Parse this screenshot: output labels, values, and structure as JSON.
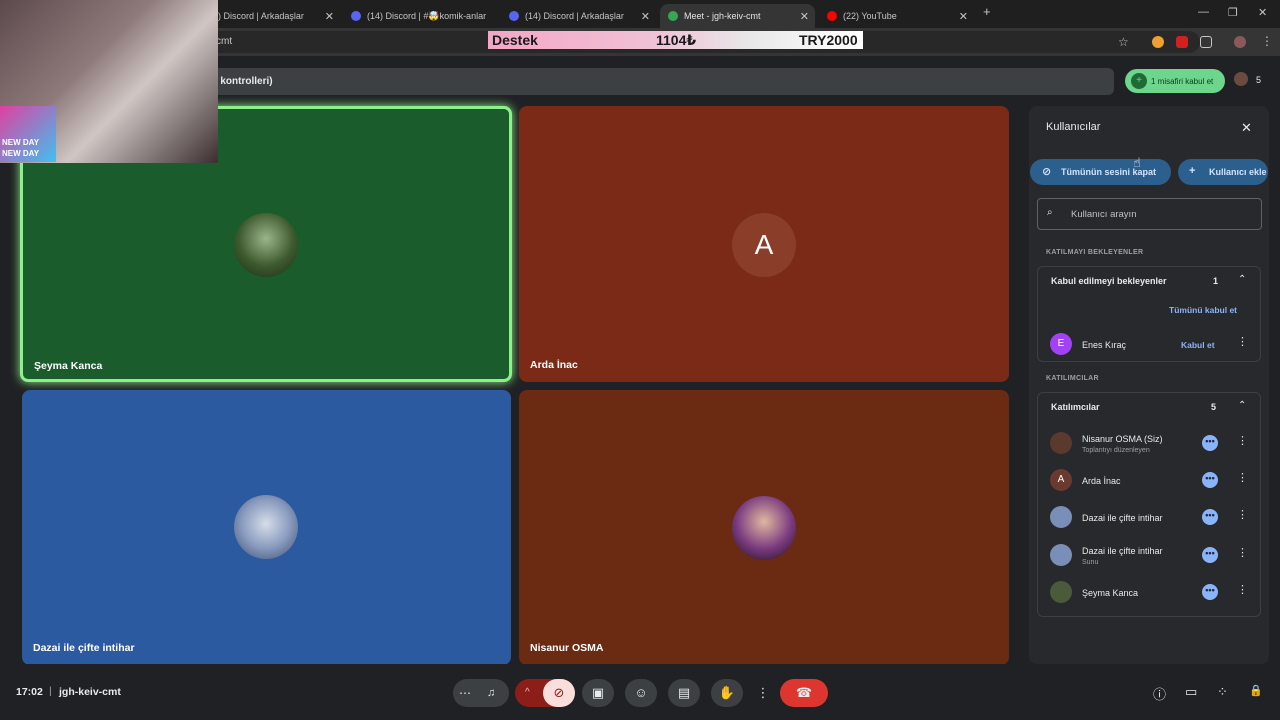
{
  "browser": {
    "tabs": [
      {
        "title": ") Discord | Arkadaşlar",
        "favicon_color": "#5865f2"
      },
      {
        "title": "(14) Discord | #🤯komik-anlar",
        "favicon_color": "#5865f2"
      },
      {
        "title": "(14) Discord | Arkadaşlar",
        "favicon_color": "#5865f2"
      },
      {
        "title": "Meet - jgh-keiv-cmt",
        "favicon_color": "#34a853"
      },
      {
        "title": "(22) YouTube",
        "favicon_color": "#ff0000"
      }
    ],
    "new_tab": "+",
    "url": "cmt",
    "window_buttons": [
      "—",
      "❐",
      "✕"
    ]
  },
  "donation_overlay": {
    "label": "Destek",
    "amount": "1104₺",
    "goal": "TRY2000"
  },
  "webcam_overlay": {
    "badge_text_1": "NEW DAY",
    "badge_text_2": "NEW DAY"
  },
  "meet": {
    "banner_text": "e kontrolleri)",
    "admit_button": "1 misafiri kabul et",
    "participant_count": "5",
    "tiles": [
      {
        "name": "Şeyma Kanca",
        "bg": "#1a5c2b",
        "speaking": true
      },
      {
        "name": "Arda İnac",
        "bg": "#7a2a16",
        "avatar_letter": "A"
      },
      {
        "name": "Dazai ile çifte intihar",
        "bg": "#2c5aa0"
      },
      {
        "name": "Nisanur OSMA",
        "bg": "#6b2a12"
      }
    ],
    "meeting_time": "17:02",
    "meeting_code": "jgh-keiv-cmt",
    "separator": "|"
  },
  "panel": {
    "title": "Kullanıcılar",
    "mute_all_button": "Tümünün sesini kapat",
    "add_user_button": "Kullanıcı ekle",
    "search_placeholder": "Kullanıcı arayın",
    "waiting_section": "KATILMAYI BEKLEYENLER",
    "waiting_card_title": "Kabul edilmeyi bekleyenler",
    "waiting_count": "1",
    "admit_all": "Tümünü kabul et",
    "waiting_people": [
      {
        "name": "Enes Kıraç",
        "initial": "E",
        "color": "#a142f4",
        "action": "Kabul et"
      }
    ],
    "participants_section": "KATILIMCILAR",
    "participants_card_title": "Katılımcılar",
    "participants_count": "5",
    "participants": [
      {
        "name": "Nisanur OSMA (Siz)",
        "sub": "Toplantıyı düzenleyen",
        "color": "#5b3a2e"
      },
      {
        "name": "Arda İnac",
        "sub": "",
        "color": "#6b3a2f",
        "initial": "A"
      },
      {
        "name": "Dazai ile çifte intihar",
        "sub": "",
        "color": "#7a8fb8"
      },
      {
        "name": "Dazai ile çifte intihar",
        "sub": "Sunu",
        "color": "#7a8fb8"
      },
      {
        "name": "Şeyma Kanca",
        "sub": "",
        "color": "#4a5a3a"
      }
    ],
    "more_dots": "•••",
    "kebab": "⋮"
  },
  "icons": {
    "close": "✕",
    "search": "🔍",
    "chevron_up": "⌃",
    "more_horiz": "⋯",
    "mic": "🎤",
    "caret_up": "^",
    "cam_off": "⊘",
    "present": "▣",
    "emoji": "☺",
    "captions": "▤",
    "hand": "✋",
    "more_vert": "⋮",
    "end_call": "☎",
    "info": "ⓘ",
    "chat": "▭",
    "apps": "⁘",
    "lock": "🔒"
  }
}
